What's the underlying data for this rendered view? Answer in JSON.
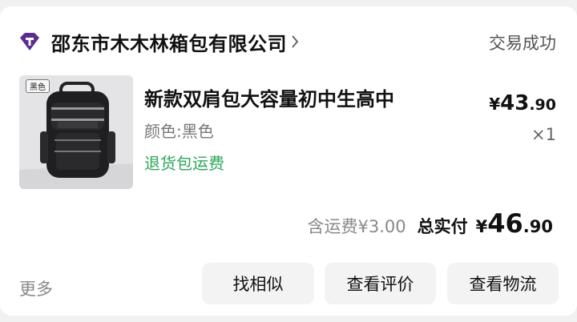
{
  "shop": {
    "name": "邵东市木木林箱包有限公司",
    "logo_icon": "store-logo-icon",
    "arrow_icon": "chevron-right-icon"
  },
  "order": {
    "status": "交易成功"
  },
  "item": {
    "image_tag": "黑色",
    "title": "新款双肩包大容量初中生高中",
    "spec": "颜色:黑色",
    "service_tag": "退货包运费",
    "price_currency": "¥",
    "price_int": "43",
    "price_dec": ".90",
    "quantity": "×1"
  },
  "summary": {
    "shipping_label": "含运费¥3.00",
    "paid_label": "总实付",
    "paid_currency": "¥",
    "paid_int": "46",
    "paid_dec": ".90"
  },
  "actions": {
    "more": "更多",
    "similar": "找相似",
    "review": "查看评价",
    "logistics": "查看物流"
  },
  "colors": {
    "service_tag": "#2ea65a",
    "logo": "#5a2d91"
  }
}
